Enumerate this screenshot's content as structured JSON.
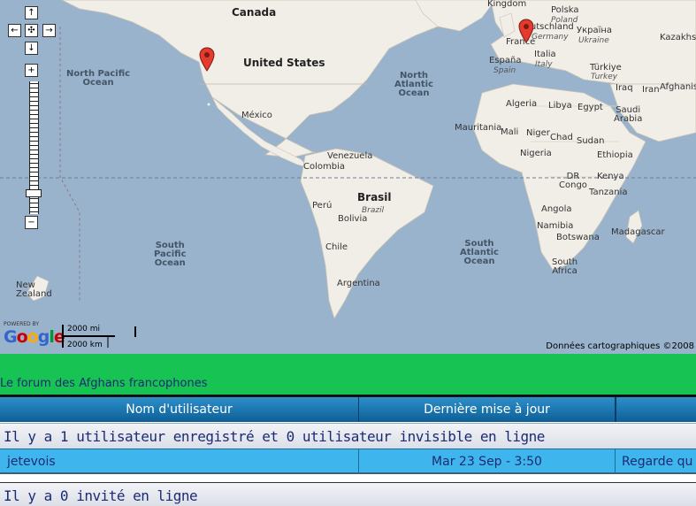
{
  "map": {
    "countries": {
      "canada": "Canada",
      "united_states": "United States",
      "mexico": "México",
      "venezuela": "Venezuela",
      "colombia": "Colombia",
      "peru": "Perú",
      "brasil": "Brasil",
      "brazil": "Brazil",
      "bolivia": "Bolivia",
      "chile": "Chile",
      "argentina": "Argentina",
      "new_zealand": "New Zealand",
      "united_kingdom": "United Kingdom",
      "deutschland": "Deutschland",
      "germany": "Germany",
      "polska": "Polska",
      "poland": "Poland",
      "ukraina": "Україна",
      "ukraine": "Ukraine",
      "france": "France",
      "espana": "España",
      "spain": "Spain",
      "italia": "Italia",
      "italy": "Italy",
      "kazakhstan": "Kazakhst",
      "turkiye": "Türkiye",
      "turkey": "Turkey",
      "iraq": "Iraq",
      "iran": "Iran",
      "afghanistan": "Afghanist",
      "algeria": "Algeria",
      "libya": "Libya",
      "egypt": "Egypt",
      "saudi": "Saudi\nArabia",
      "mauritania": "Mauritania",
      "mali": "Mali",
      "niger": "Niger",
      "chad": "Chad",
      "sudan": "Sudan",
      "nigeria": "Nigeria",
      "ethiopia": "Ethiopia",
      "drc": "DR\nCongo",
      "kenya": "Kenya",
      "tanzania": "Tanzania",
      "angola": "Angola",
      "namibia": "Namibia",
      "botswana": "Botswana",
      "madagascar": "Madagascar",
      "south_africa": "South\nAfrica"
    },
    "oceans": {
      "north_pacific": "North Pacific\nOcean",
      "north_atlantic": "North\nAtlantic\nOcean",
      "south_pacific": "South\nPacific\nOcean",
      "south_atlantic": "South\nAtlantic\nOcean"
    },
    "controls": {
      "pan_up": "↑",
      "pan_left": "←",
      "pan_center": "✣",
      "pan_right": "→",
      "pan_down": "↓",
      "zoom_in": "+",
      "zoom_out": "−"
    },
    "powered_by": "POWERED BY",
    "google": [
      "G",
      "o",
      "o",
      "g",
      "l",
      "e"
    ],
    "google_colors": [
      "#3366cc",
      "#cc0000",
      "#ffaa00",
      "#3366cc",
      "#009933",
      "#cc0000"
    ],
    "scale_mi": "2000 mi",
    "scale_km": "2000 km",
    "copyright": "Données cartographiques ©2008",
    "colors": {
      "ocean": "#99b3cc",
      "land": "#f1eee8",
      "pin": "#e53b2f"
    }
  },
  "forum": {
    "title": "Le forum des Afghans francophones"
  },
  "table": {
    "headers": [
      "Nom d'utilisateur",
      "Dernière mise à jour",
      ""
    ],
    "registered_info": "Il y a 1 utilisateur enregistré et 0 utilisateur invisible en ligne",
    "rows": [
      {
        "user": "jetevois",
        "updated": "Mar 23 Sep - 3:50",
        "location": "Regarde qu"
      }
    ],
    "guests_info": "Il y a 0 invité en ligne",
    "colors": {
      "header": "#1a74b0",
      "row": "#3fb5ee",
      "bar": "#17c353"
    }
  }
}
